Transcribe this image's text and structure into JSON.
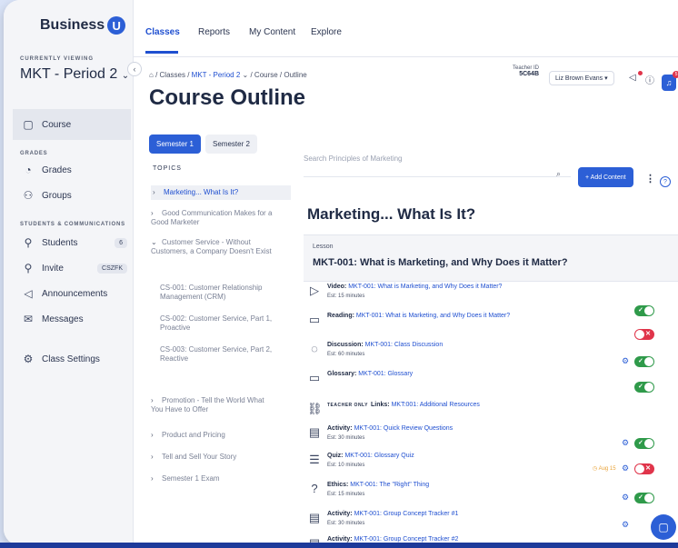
{
  "brand": {
    "name": "Business",
    "badge": "U"
  },
  "sidebar": {
    "currently_viewing_label": "CURRENTLY VIEWING",
    "class_name": "MKT - Period 2",
    "course_label": "Course",
    "grades_section": "GRADES",
    "grades_label": "Grades",
    "groups_label": "Groups",
    "students_section": "STUDENTS & COMMUNICATIONS",
    "students_label": "Students",
    "students_count": "6",
    "invite_label": "Invite",
    "invite_code": "CSZFK",
    "announcements_label": "Announcements",
    "messages_label": "Messages",
    "class_settings_label": "Class Settings"
  },
  "topnav": {
    "tabs": [
      "Classes",
      "Reports",
      "My Content",
      "Explore"
    ]
  },
  "breadcrumb": {
    "home": "⌂",
    "classes": "/ Classes /",
    "period": "MKT - Period 2",
    "rest": "⌄ / Course / Outline"
  },
  "page_title": "Course Outline",
  "header": {
    "teacher_id_label": "Teacher ID",
    "teacher_id": "5C64B",
    "user_name": "Liz Brown Evans ▾",
    "notif_count": "5"
  },
  "semesters": [
    "Semester 1",
    "Semester 2"
  ],
  "topics_label": "TOPICS",
  "topics": [
    {
      "label": "Marketing... What Is It?",
      "chev": "›"
    },
    {
      "label": "Good Communication Makes for a Good Marketer",
      "chev": "›"
    },
    {
      "label": "Customer Service - Without Customers, a Company Doesn't Exist",
      "chev": "⌄"
    },
    {
      "label": "CS-001: Customer Relationship Management (CRM)",
      "chev": ""
    },
    {
      "label": "CS-002: Customer Service, Part 1, Proactive",
      "chev": ""
    },
    {
      "label": "CS-003: Customer Service, Part 2, Reactive",
      "chev": ""
    },
    {
      "label": "Promotion - Tell the World What You Have to Offer",
      "chev": "›"
    },
    {
      "label": "Product and Pricing",
      "chev": "›"
    },
    {
      "label": "Tell and Sell Your Story",
      "chev": "›"
    },
    {
      "label": "Semester 1 Exam",
      "chev": "›"
    }
  ],
  "search": {
    "placeholder": "Search Principles of Marketing"
  },
  "add_content_label": "+ Add Content",
  "section_title": "Marketing... What Is It?",
  "lesson": {
    "label": "Lesson",
    "title": "MKT-001: What is Marketing, and Why Does it Matter?"
  },
  "items": [
    {
      "type": "Video:",
      "title": "MKT-001: What is Marketing, and Why Does it Matter?",
      "est": "Est: 15 minutes",
      "icon": "▷"
    },
    {
      "type": "Reading:",
      "title": "MKT-001: What is Marketing, and Why Does it Matter?",
      "est": "",
      "icon": "▭"
    },
    {
      "type": "Discussion:",
      "title": "MKT-001: Class Discussion",
      "est": "Est: 60 minutes",
      "icon": "◌"
    },
    {
      "type": "Glossary:",
      "title": "MKT-001: Glossary",
      "est": "",
      "icon": "▭"
    },
    {
      "type": "Links:",
      "title": "MKT:001: Additional Resources",
      "est": "",
      "icon": "⛓",
      "teacher_only": "TEACHER ONLY"
    },
    {
      "type": "Activity:",
      "title": "MKT-001: Quick Review Questions",
      "est": "Est: 30 minutes",
      "icon": "▤"
    },
    {
      "type": "Quiz:",
      "title": "MKT-001: Glossary Quiz",
      "est": "Est: 10 minutes",
      "icon": "☰"
    },
    {
      "type": "Ethics:",
      "title": "MKT-001: The \"Right\" Thing",
      "est": "Est: 15 minutes",
      "icon": "?"
    },
    {
      "type": "Activity:",
      "title": "MKT-001: Group Concept Tracker #1",
      "est": "Est: 30 minutes",
      "icon": "▤"
    },
    {
      "type": "Activity:",
      "title": "MKT-001: Group Concept Tracker #2",
      "est": "",
      "icon": "▤"
    }
  ],
  "due_label": "Aug 15",
  "colors": {
    "primary": "#2c5fd6",
    "on": "#2f9a4a",
    "off": "#e0344a"
  }
}
